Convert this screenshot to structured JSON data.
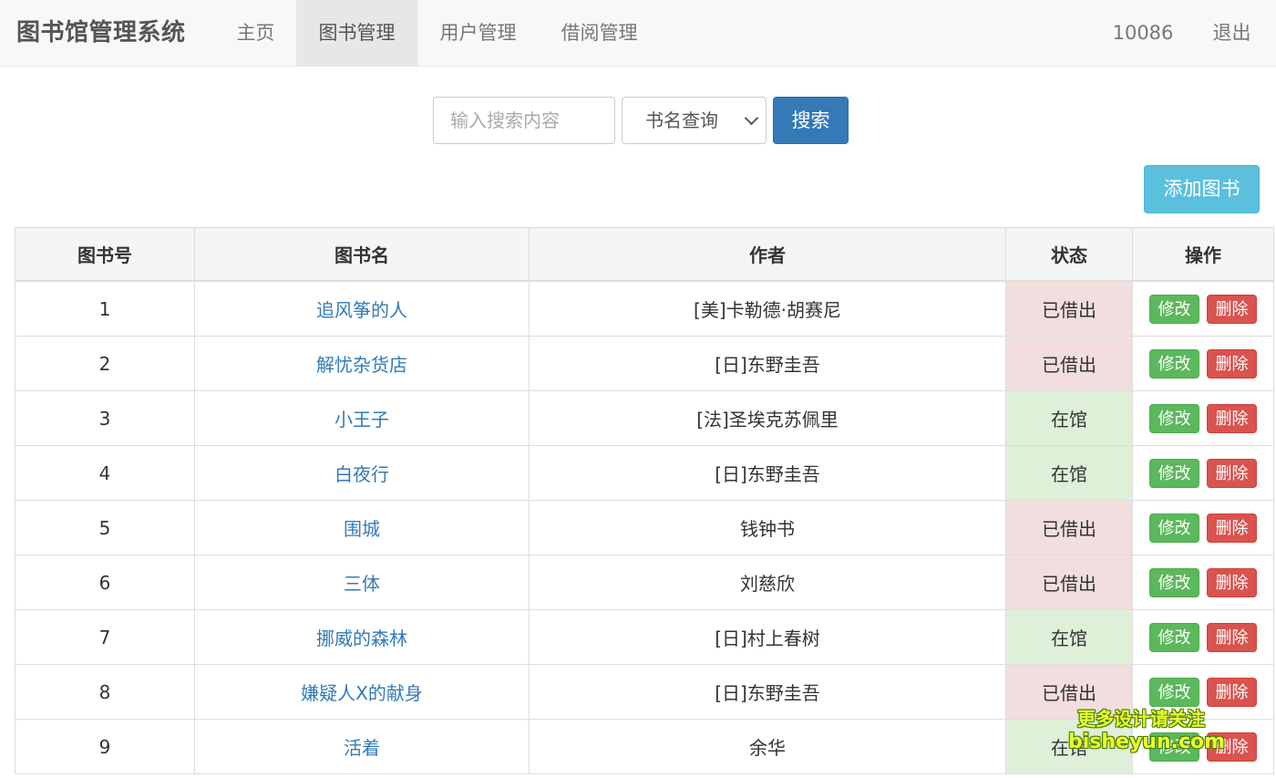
{
  "navbar": {
    "brand": "图书馆管理系统",
    "items": [
      {
        "label": "主页"
      },
      {
        "label": "图书管理",
        "active": true
      },
      {
        "label": "用户管理"
      },
      {
        "label": "借阅管理"
      }
    ],
    "user_id": "10086",
    "logout": "退出"
  },
  "search": {
    "placeholder": "输入搜索内容",
    "select_value": "书名查询",
    "button": "搜索"
  },
  "add_button": "添加图书",
  "table": {
    "headers": [
      "图书号",
      "图书名",
      "作者",
      "状态",
      "操作"
    ],
    "edit_label": "修改",
    "delete_label": "删除",
    "rows": [
      {
        "id": "1",
        "name": "追风筝的人",
        "author": "[美]卡勒德·胡赛尼",
        "status": "已借出"
      },
      {
        "id": "2",
        "name": "解忧杂货店",
        "author": "[日]东野圭吾",
        "status": "已借出"
      },
      {
        "id": "3",
        "name": "小王子",
        "author": "[法]圣埃克苏佩里",
        "status": "在馆"
      },
      {
        "id": "4",
        "name": "白夜行",
        "author": "[日]东野圭吾",
        "status": "在馆"
      },
      {
        "id": "5",
        "name": "围城",
        "author": "钱钟书",
        "status": "已借出"
      },
      {
        "id": "6",
        "name": "三体",
        "author": "刘慈欣",
        "status": "已借出"
      },
      {
        "id": "7",
        "name": "挪威的森林",
        "author": "[日]村上春树",
        "status": "在馆"
      },
      {
        "id": "8",
        "name": "嫌疑人X的献身",
        "author": "[日]东野圭吾",
        "status": "已借出"
      },
      {
        "id": "9",
        "name": "活着",
        "author": "余华",
        "status": "在馆"
      }
    ]
  },
  "colors": {
    "borrowed_bg": "#f2dede",
    "available_bg": "#dff0d8",
    "primary": "#337ab7",
    "info": "#5bc0de",
    "success": "#5cb85c",
    "danger": "#d9534f"
  },
  "watermark": {
    "line1": "更多设计请关注",
    "line2": "bisheyun.com"
  }
}
